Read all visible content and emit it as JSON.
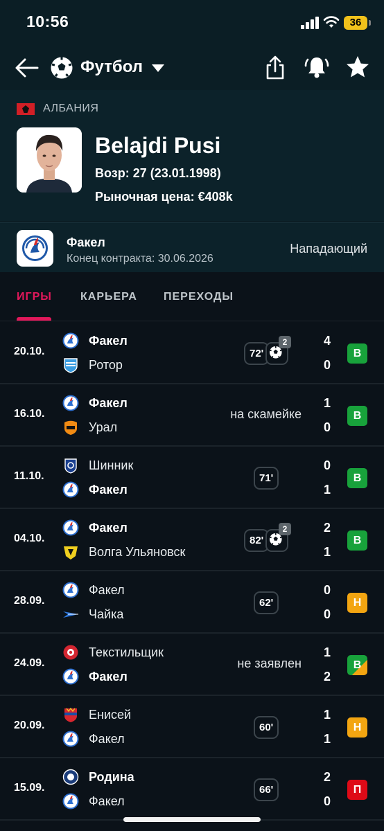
{
  "status_bar": {
    "time": "10:56",
    "battery": "36"
  },
  "app_bar": {
    "sport": "Футбол"
  },
  "player": {
    "country": "АЛБАНИЯ",
    "name": "Belajdi Pusi",
    "age": "Возр: 27 (23.01.1998)",
    "market_value": "Рыночная цена: €408k"
  },
  "club": {
    "name": "Факел",
    "contract": "Конец контракта: 30.06.2026",
    "position": "Нападающий"
  },
  "tabs": [
    {
      "label": "ИГРЫ",
      "active": true
    },
    {
      "label": "КАРЬЕРА",
      "active": false
    },
    {
      "label": "ПЕРЕХОДЫ",
      "active": false
    }
  ],
  "matches": [
    {
      "date": "20.10.",
      "team1": "Факел",
      "team1_logo": "fakel",
      "team1_bold": true,
      "team2": "Ротор",
      "team2_logo": "rotor",
      "team2_bold": false,
      "score1": "4",
      "score2": "0",
      "minutes": "72'",
      "goals": "2",
      "note": "",
      "result": "В",
      "result_type": "win"
    },
    {
      "date": "16.10.",
      "team1": "Факел",
      "team1_logo": "fakel",
      "team1_bold": true,
      "team2": "Урал",
      "team2_logo": "ural",
      "team2_bold": false,
      "score1": "1",
      "score2": "0",
      "minutes": "",
      "goals": "",
      "note": "на скамейке",
      "result": "В",
      "result_type": "win"
    },
    {
      "date": "11.10.",
      "team1": "Шинник",
      "team1_logo": "shinnik",
      "team1_bold": false,
      "team2": "Факел",
      "team2_logo": "fakel",
      "team2_bold": true,
      "score1": "0",
      "score2": "1",
      "minutes": "71'",
      "goals": "",
      "note": "",
      "result": "В",
      "result_type": "win"
    },
    {
      "date": "04.10.",
      "team1": "Факел",
      "team1_logo": "fakel",
      "team1_bold": true,
      "team2": "Волга Ульяновск",
      "team2_logo": "volga",
      "team2_bold": false,
      "score1": "2",
      "score2": "1",
      "minutes": "82'",
      "goals": "2",
      "note": "",
      "result": "В",
      "result_type": "win"
    },
    {
      "date": "28.09.",
      "team1": "Факел",
      "team1_logo": "fakel",
      "team1_bold": false,
      "team2": "Чайка",
      "team2_logo": "chayka",
      "team2_bold": false,
      "score1": "0",
      "score2": "0",
      "minutes": "62'",
      "goals": "",
      "note": "",
      "result": "Н",
      "result_type": "draw"
    },
    {
      "date": "24.09.",
      "team1": "Текстильщик",
      "team1_logo": "tekstilshchik",
      "team1_bold": false,
      "team2": "Факел",
      "team2_logo": "fakel",
      "team2_bold": true,
      "score1": "1",
      "score2": "2",
      "minutes": "",
      "goals": "",
      "note": "не заявлен",
      "result": "В",
      "result_type": "split"
    },
    {
      "date": "20.09.",
      "team1": "Енисей",
      "team1_logo": "yenisey",
      "team1_bold": false,
      "team2": "Факел",
      "team2_logo": "fakel",
      "team2_bold": false,
      "score1": "1",
      "score2": "1",
      "minutes": "60'",
      "goals": "",
      "note": "",
      "result": "Н",
      "result_type": "draw"
    },
    {
      "date": "15.09.",
      "team1": "Родина",
      "team1_logo": "rodina",
      "team1_bold": true,
      "team2": "Факел",
      "team2_logo": "fakel",
      "team2_bold": false,
      "score1": "2",
      "score2": "0",
      "minutes": "66'",
      "goals": "",
      "note": "",
      "result": "П",
      "result_type": "loss"
    }
  ]
}
